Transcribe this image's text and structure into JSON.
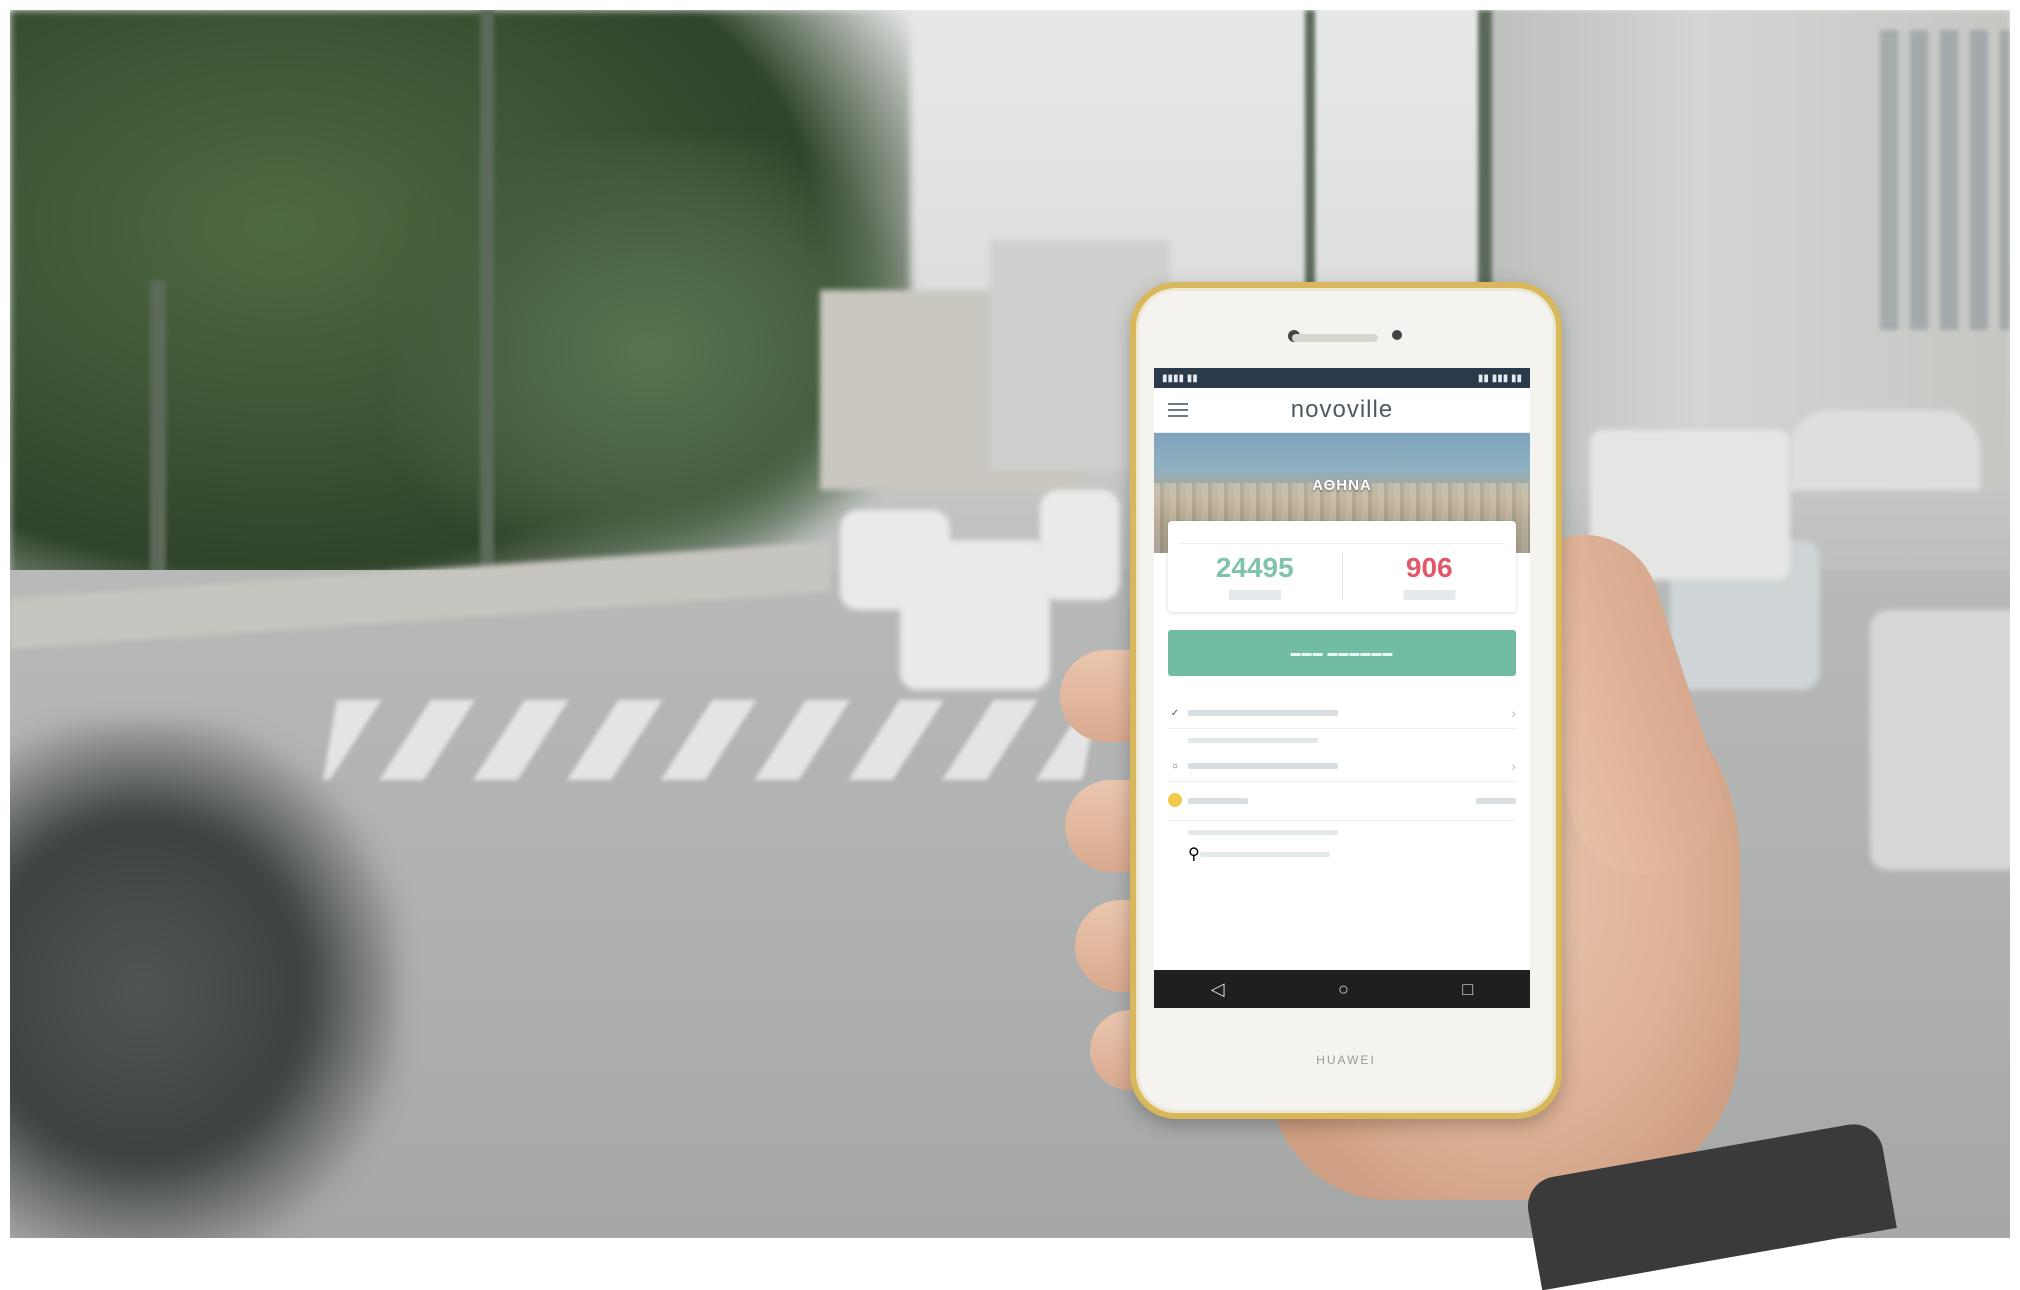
{
  "app": {
    "title": "novoville",
    "banner_label": "ΑΘΗΝΑ",
    "stats": [
      {
        "value": "24495",
        "color": "#7fc2ae"
      },
      {
        "value": "906",
        "color": "#e0586a"
      }
    ],
    "phone_brand": "HUAWEI"
  },
  "icons": {
    "menu": "hamburger-icon",
    "back": "◁",
    "home": "○",
    "recents": "□",
    "chevron": "›",
    "check": "✓"
  }
}
